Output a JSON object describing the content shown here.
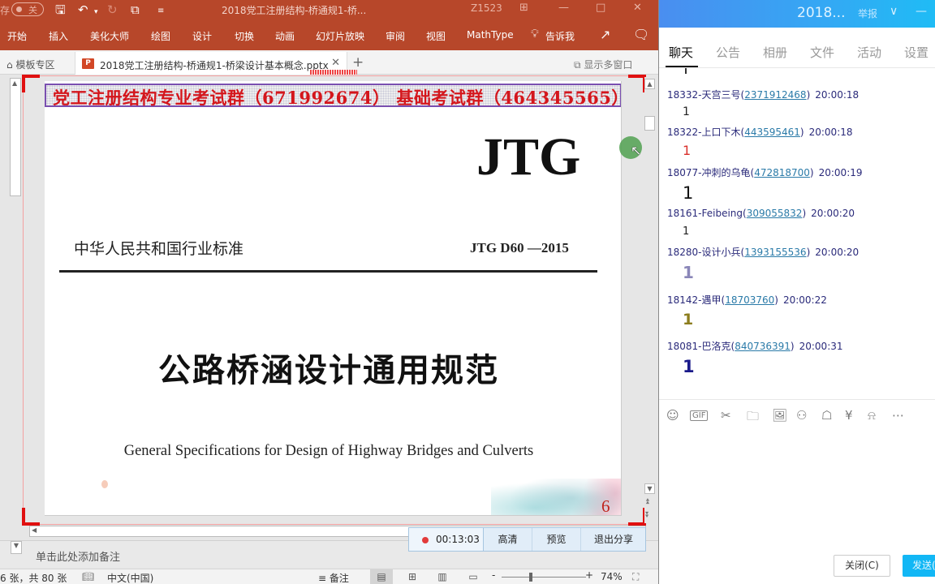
{
  "ppt": {
    "titlebar": {
      "autosave_prefix": "存",
      "autosave_state": "关",
      "title": "2018党工注册结构-桥通规1-桥...",
      "user": "Z1523"
    },
    "ribbon_tabs": [
      "开始",
      "插入",
      "美化大师",
      "绘图",
      "设计",
      "切换",
      "动画",
      "幻灯片放映",
      "审阅",
      "视图",
      "MathType"
    ],
    "tell_me": "告诉我",
    "tabstrip": {
      "home_tab": "模板专区",
      "doc_tab": "2018党工注册结构-桥通规1-桥梁设计基本概念.pptx",
      "multi_window": "显示多窗口"
    },
    "slide": {
      "banner": "党工注册结构专业考试群（671992674）  基础考试群（464345565）",
      "logo": "JTG",
      "standard_cn": "中华人民共和国行业标准",
      "standard_code": "JTG D60 —2015",
      "title_cn": "公路桥涵设计通用规范",
      "title_en": "General Specifications for Design of Highway Bridges and Culverts",
      "page_number": "6"
    },
    "notes_placeholder": "单击此处添加备注",
    "share_bar": {
      "elapsed": "00:13:03",
      "hd": "高清",
      "preview": "预览",
      "exit": "退出分享"
    },
    "status": {
      "slide_info": "6 张，共 80 张",
      "language": "中文(中国)",
      "notes": "备注",
      "zoom": "74%",
      "zoom_level_percent": 74
    }
  },
  "chat": {
    "header": {
      "title": "2018...",
      "report": "举报"
    },
    "tabs": [
      "聊天",
      "公告",
      "相册",
      "文件",
      "活动",
      "设置"
    ],
    "active_tab": "聊天",
    "messages": [
      {
        "sender": "18332-天宫三号",
        "qq": "2371912468",
        "time": "20:00:18",
        "text": "1",
        "color": "#222222"
      },
      {
        "sender": "18322-上口下木",
        "qq": "443595461",
        "time": "20:00:18",
        "text": "1",
        "color": "#d9302c"
      },
      {
        "sender": "18077-冲刺的乌龟",
        "qq": "472818700",
        "time": "20:00:19",
        "text": "1",
        "color": "#111111"
      },
      {
        "sender": "18161-Feibeing",
        "qq": "309055832",
        "time": "20:00:20",
        "text": "1",
        "color": "#222222"
      },
      {
        "sender": "18280-设计小兵",
        "qq": "1393155536",
        "time": "20:00:20",
        "text": "1",
        "color": "#8a86b8"
      },
      {
        "sender": "18142-遇甲",
        "qq": "18703760",
        "time": "20:00:22",
        "text": "1",
        "color": "#8c7d1e"
      },
      {
        "sender": "18081-巴洛克",
        "qq": "840736391",
        "time": "20:00:31",
        "text": "1",
        "color": "#1a1a8a"
      }
    ],
    "toolbar_icons": [
      "emoji-icon",
      "gif-icon",
      "screenshot-icon",
      "folder-icon",
      "image-icon",
      "avatar-show-icon",
      "gift-icon",
      "red-packet-icon",
      "bell-icon",
      "more-icon"
    ],
    "close_button": "关闭(C)",
    "send_button": "发送("
  }
}
